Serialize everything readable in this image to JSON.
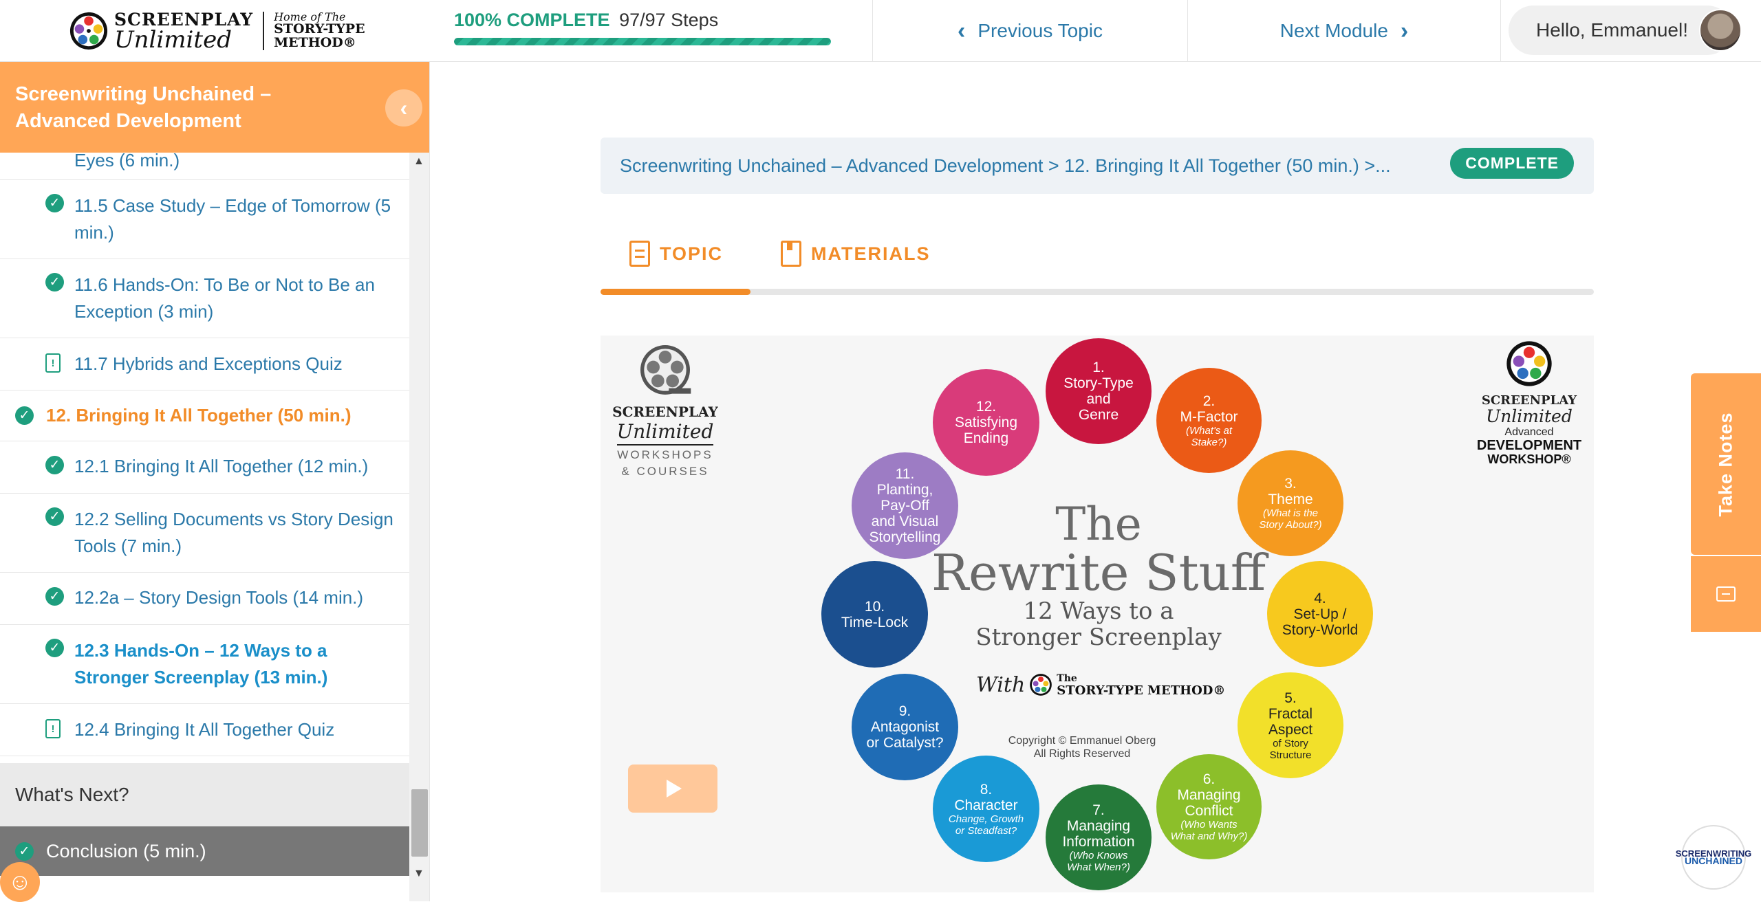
{
  "header": {
    "logo": {
      "line1": "SCREENPLAY",
      "line2": "Unlimited",
      "home_of": "Home of The",
      "stm": "STORY-TYPE",
      "stm2": "METHOD®"
    },
    "progress": {
      "percent_label": "100% COMPLETE",
      "steps": "97/97 Steps",
      "fraction": 1.0
    },
    "prev_label": "Previous Topic",
    "next_label": "Next Module",
    "greeting": "Hello, Emmanuel!"
  },
  "sidebar": {
    "course_title": "Screenwriting Unchained – Advanced Development",
    "items": [
      {
        "label": "Eyes (6 min.)",
        "icon": "none"
      },
      {
        "label": "11.5 Case Study – Edge of Tomorrow (5 min.)",
        "icon": "check-icon"
      },
      {
        "label": "11.6 Hands-On: To Be or Not to Be an Exception (3 min)",
        "icon": "check-icon"
      },
      {
        "label": "11.7 Hybrids and Exceptions Quiz",
        "icon": "quiz-icon"
      },
      {
        "label": "12. Bringing It All Together (50 min.)",
        "icon": "check-icon"
      },
      {
        "label": "12.1 Bringing It All Together (12 min.)",
        "icon": "check-icon"
      },
      {
        "label": "12.2 Selling Documents vs Story Design Tools (7 min.)",
        "icon": "check-icon"
      },
      {
        "label": "12.2a – Story Design Tools (14 min.)",
        "icon": "check-icon"
      },
      {
        "label": "12.3 Hands-On – 12 Ways to a Stronger Screenplay (13 min.)",
        "icon": "check-icon"
      },
      {
        "label": "12.4 Bringing It All Together Quiz",
        "icon": "quiz-icon"
      }
    ],
    "section_label": "What's Next?",
    "conclusion_label": "Conclusion (5 min.)"
  },
  "main": {
    "breadcrumb": "Screenwriting Unchained – Advanced Development > 12. Bringing It All Together (50 min.) >...",
    "badge": "COMPLETE",
    "tabs": [
      {
        "label": "TOPIC"
      },
      {
        "label": "MATERIALS"
      }
    ],
    "video": {
      "left_logo": {
        "l1": "SCREENPLAY",
        "l2": "Unlimited",
        "l3": "WORKSHOPS",
        "l4": "& COURSES"
      },
      "right_logo": {
        "l1": "SCREENPLAY",
        "l2": "Unlimited",
        "l3": "Advanced",
        "l4": "DEVELOPMENT",
        "l5": "WORKSHOP®"
      },
      "title1": "The",
      "title2": "Rewrite Stuff",
      "subtitle1": "12 Ways to a",
      "subtitle2": "Stronger Screenplay",
      "with": "With",
      "stm1": "The",
      "stm2": "STORY-TYPE METHOD®",
      "copy1": "Copyright © Emmanuel Oberg",
      "copy2": "All Rights Reserved",
      "circles": [
        {
          "l1": "1.",
          "l2": "Story-Type",
          "l3": "and",
          "l4": "Genre",
          "sub": ""
        },
        {
          "l1": "2.",
          "l2": "M-Factor",
          "l3": "",
          "l4": "",
          "sub": "(What's at Stake?)"
        },
        {
          "l1": "3.",
          "l2": "Theme",
          "l3": "",
          "l4": "",
          "sub": "(What is the Story About?)"
        },
        {
          "l1": "4.",
          "l2": "Set-Up /",
          "l3": "Story-World",
          "l4": "",
          "sub": ""
        },
        {
          "l1": "5.",
          "l2": "Fractal",
          "l3": "Aspect",
          "l4": "",
          "sub": "of Story Structure"
        },
        {
          "l1": "6.",
          "l2": "Managing",
          "l3": "Conflict",
          "l4": "",
          "sub": "(Who Wants What and Why?)"
        },
        {
          "l1": "7.",
          "l2": "Managing",
          "l3": "Information",
          "l4": "",
          "sub": "(Who Knows What When?)"
        },
        {
          "l1": "8.",
          "l2": "Character",
          "l3": "",
          "l4": "",
          "sub": "Change, Growth or Steadfast?"
        },
        {
          "l1": "9.",
          "l2": "Antagonist",
          "l3": "or Catalyst?",
          "l4": "",
          "sub": ""
        },
        {
          "l1": "10.",
          "l2": "Time-Lock",
          "l3": "",
          "l4": "",
          "sub": ""
        },
        {
          "l1": "11.",
          "l2": "Planting,",
          "l3": "Pay-Off",
          "l4": "and Visual Storytelling",
          "sub": ""
        },
        {
          "l1": "12.",
          "l2": "Satisfying",
          "l3": "Ending",
          "l4": "",
          "sub": ""
        }
      ]
    }
  },
  "notes_tab": {
    "label": "Take Notes"
  },
  "corner_logo": {
    "l1": "SCREENWRITING",
    "l2": "UNCHAINED"
  },
  "colors": {
    "accent": "#ffa656",
    "orange_text": "#f28c28",
    "link_blue": "#2b79a9",
    "complete_green": "#1e9e7e"
  }
}
